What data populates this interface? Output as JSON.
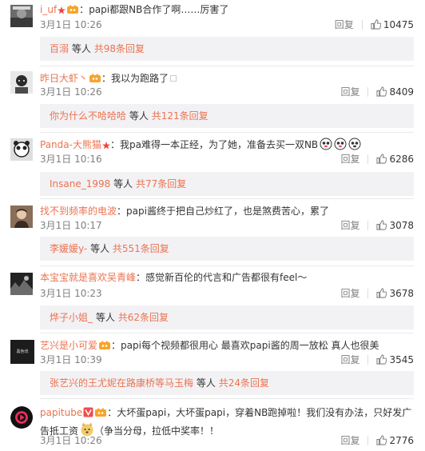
{
  "colors": {
    "username": "#eb7350",
    "subbox_bg": "#f2f2f5",
    "meta": "#808080"
  },
  "comments": [
    {
      "user": "i_uf",
      "text": "papi都跟NB合作了啊……厉害了",
      "time": "3月1日 10:26",
      "reply_label": "回复",
      "likes": "10475",
      "sub": {
        "names": "百溺",
        "etc": "等人",
        "total": "共98条回复"
      }
    },
    {
      "user": "昨日大虾丶",
      "text": "我以为跑路了",
      "time": "3月1日 10:26",
      "reply_label": "回复",
      "likes": "8409",
      "sub": {
        "names": "你为什么不哈哈哈",
        "etc": "等人",
        "total": "共121条回复"
      }
    },
    {
      "user": "Panda-大熊猫",
      "text": "我pa难得一本正经，为了她，准备去买一双NB",
      "time": "3月1日 10:16",
      "reply_label": "回复",
      "likes": "6286",
      "sub": {
        "names": "Insane_1998",
        "etc": "等人",
        "total": "共77条回复"
      }
    },
    {
      "user": "找不到频率的电波",
      "text": "papi酱终于把自己炒红了，也是煞费苦心，累了",
      "time": "3月1日 10:17",
      "reply_label": "回复",
      "likes": "3078",
      "sub": {
        "names": "李媛媛y-",
        "etc": "等人",
        "total": "共551条回复"
      }
    },
    {
      "user": "本宝宝就是喜欢吴青峰",
      "text": "感觉新百伦的代言和广告都很有feel～",
      "time": "3月1日 10:23",
      "reply_label": "回复",
      "likes": "3678",
      "sub": {
        "names": "烨子小姐_",
        "etc": "等人",
        "total": "共62条回复"
      }
    },
    {
      "user": "艺兴是小可爱",
      "text": "papi每个视频都很用心 最喜欢papi酱的周一放松 真人也很美",
      "time": "3月1日 10:39",
      "reply_label": "回复",
      "likes": "3545",
      "avatar_text": "黑色伐",
      "sub": {
        "names": "张艺兴的王尤妮在路康桥等马玉梅",
        "etc": "等人",
        "total": "共24条回复"
      }
    },
    {
      "user": "papitube",
      "text_part1": "大坏蛋papi，大坏蛋papi，穿着NB跑掉啦！我们没有办法，只好发广",
      "text_part2a": "告抵工资",
      "text_part2b": "（争当分母，拉低中奖率！！",
      "time": "3月1日 10:26",
      "reply_label": "回复",
      "likes": "2776"
    }
  ]
}
